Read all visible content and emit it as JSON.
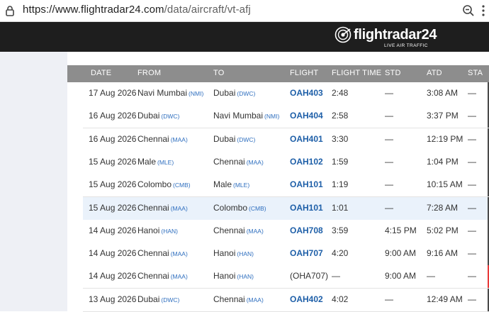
{
  "browser": {
    "url_host": "https://www.flightradar24.com",
    "url_path": "/data/aircraft/vt-afj"
  },
  "site": {
    "logo_text": "flightradar24",
    "logo_sub": "LIVE AIR TRAFFIC"
  },
  "table": {
    "headers": [
      "DATE",
      "FROM",
      "TO",
      "FLIGHT",
      "FLIGHT TIME",
      "STD",
      "ATD",
      "STA"
    ],
    "rows": [
      {
        "date": "17 Aug 2026",
        "from": "Navi Mumbai",
        "from_code": "(NMI)",
        "to": "Dubai",
        "to_code": "(DWC)",
        "flight": "OAH403",
        "time": "2:48",
        "std": "—",
        "atd": "3:08 AM",
        "sta": "—",
        "bar": "dark"
      },
      {
        "date": "16 Aug 2026",
        "from": "Dubai",
        "from_code": "(DWC)",
        "to": "Navi Mumbai",
        "to_code": "(NMI)",
        "flight": "OAH404",
        "time": "2:58",
        "std": "—",
        "atd": "3:37 PM",
        "sta": "—",
        "bar": "dark"
      },
      {
        "date": "16 Aug 2026",
        "from": "Chennai",
        "from_code": "(MAA)",
        "to": "Dubai",
        "to_code": "(DWC)",
        "flight": "OAH401",
        "time": "3:30",
        "std": "—",
        "atd": "12:19 PM",
        "sta": "—",
        "bar": "dark"
      },
      {
        "date": "15 Aug 2026",
        "from": "Male",
        "from_code": "(MLE)",
        "to": "Chennai",
        "to_code": "(MAA)",
        "flight": "OAH102",
        "time": "1:59",
        "std": "—",
        "atd": "1:04 PM",
        "sta": "—",
        "bar": "dark"
      },
      {
        "date": "15 Aug 2026",
        "from": "Colombo",
        "from_code": "(CMB)",
        "to": "Male",
        "to_code": "(MLE)",
        "flight": "OAH101",
        "time": "1:19",
        "std": "—",
        "atd": "10:15 AM",
        "sta": "—",
        "bar": "dark"
      },
      {
        "date": "15 Aug 2026",
        "from": "Chennai",
        "from_code": "(MAA)",
        "to": "Colombo",
        "to_code": "(CMB)",
        "flight": "OAH101",
        "time": "1:01",
        "std": "—",
        "atd": "7:28 AM",
        "sta": "—",
        "bar": "dark",
        "highlight": true
      },
      {
        "date": "14 Aug 2026",
        "from": "Hanoi",
        "from_code": "(HAN)",
        "to": "Chennai",
        "to_code": "(MAA)",
        "flight": "OAH708",
        "time": "3:59",
        "std": "4:15 PM",
        "atd": "5:02 PM",
        "sta": "—",
        "bar": "dark"
      },
      {
        "date": "14 Aug 2026",
        "from": "Chennai",
        "from_code": "(MAA)",
        "to": "Hanoi",
        "to_code": "(HAN)",
        "flight": "OAH707",
        "time": "4:20",
        "std": "9:00 AM",
        "atd": "9:16 AM",
        "sta": "—",
        "bar": "dark"
      },
      {
        "date": "14 Aug 2026",
        "from": "Chennai",
        "from_code": "(MAA)",
        "to": "Hanoi",
        "to_code": "(HAN)",
        "flight": "(OHA707)",
        "flight_plain": true,
        "time": "—",
        "std": "9:00 AM",
        "atd": "—",
        "sta": "—",
        "bar": "red"
      },
      {
        "date": "13 Aug 2026",
        "from": "Dubai",
        "from_code": "(DWC)",
        "to": "Chennai",
        "to_code": "(MAA)",
        "flight": "OAH402",
        "time": "4:02",
        "std": "—",
        "atd": "12:49 AM",
        "sta": "—",
        "bar": "dark"
      }
    ]
  },
  "colors": {
    "header_bg": "#1e1e1e",
    "table_header_bg": "#8d8d8d",
    "link_blue": "#1e5fa8",
    "airport_code": "#2f6fbf",
    "highlight_row": "#eaf2fb",
    "cancel_bar": "#e83a3a"
  },
  "icons": [
    "lock-icon",
    "zoom-icon",
    "more-icon",
    "flightradar-logo-icon"
  ]
}
